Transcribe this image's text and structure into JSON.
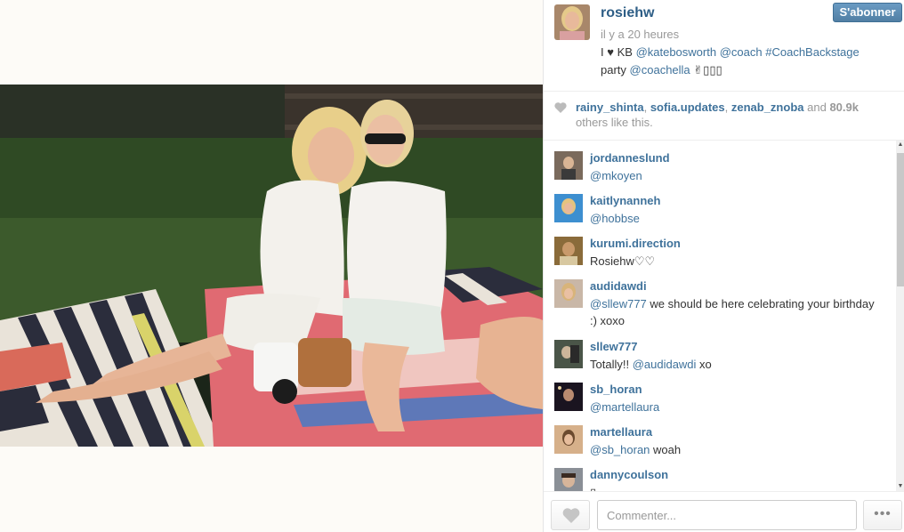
{
  "post": {
    "owner": "rosiehw",
    "time_ago": "il y a 20 heures",
    "follow_label": "S'abonner",
    "caption": {
      "prefix": "I",
      "heart": "♥",
      "kb": "KB",
      "mention1": "@katebosworth",
      "mention2": "@coach",
      "hashtag": "#CoachBackstage",
      "word": "party",
      "mention3": "@coachella",
      "emoji": "✌▯▯▯"
    }
  },
  "likes": {
    "users": [
      "rainy_shinta",
      "sofia.updates",
      "zenab_znoba"
    ],
    "and": "and",
    "count": "80.9k",
    "suffix": "others like this."
  },
  "comments": [
    {
      "user": "jordanneslund",
      "mention": "@mkoyen",
      "text": ""
    },
    {
      "user": "kaitlynanneh",
      "mention": "@hobbse",
      "text": ""
    },
    {
      "user": "kurumi.direction",
      "mention": "",
      "text": "Rosiehw♡♡"
    },
    {
      "user": "audidawdi",
      "mention": "@sllew777",
      "text": " we should be here celebrating your birthday :) xoxo"
    },
    {
      "user": "sllew777",
      "mention": "@audidawdi",
      "text": " xo",
      "prefix": "Totally!! "
    },
    {
      "user": "sb_horan",
      "mention": "@martellaura",
      "text": ""
    },
    {
      "user": "martellaura",
      "mention": "@sb_horan",
      "text": " woah"
    },
    {
      "user": "dannycoulson",
      "mention": "",
      "text": "▯"
    }
  ],
  "footer": {
    "comment_placeholder": "Commenter...",
    "more_label": "•••"
  },
  "icons": {
    "heart": "heart-icon",
    "more": "ellipsis-icon"
  },
  "colors": {
    "link": "#3f729b",
    "follow_button": "#517fa4"
  }
}
